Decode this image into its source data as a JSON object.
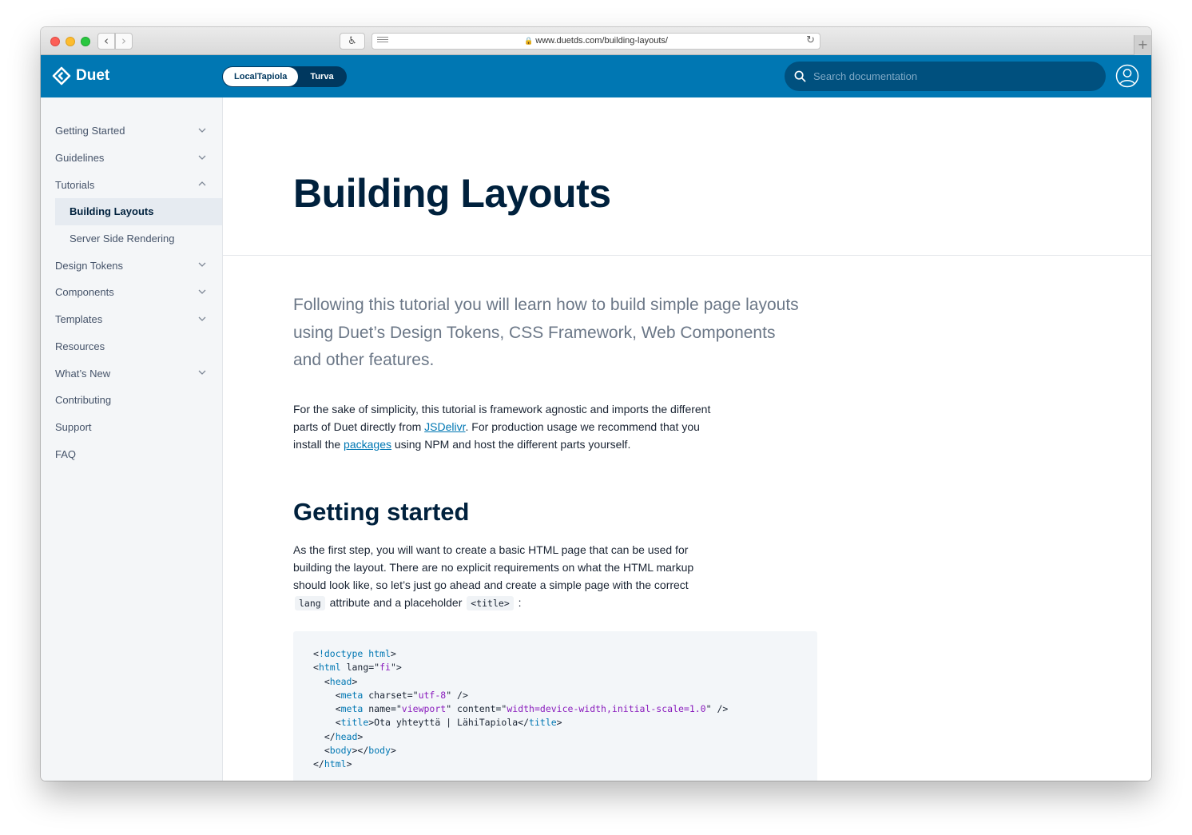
{
  "browser": {
    "url": "www.duetds.com/building-layouts/",
    "back_label": "‹",
    "forward_label": "›",
    "accessibility_glyph": "♿",
    "reload_glyph": "↻",
    "newtab_glyph": "+"
  },
  "header": {
    "logo_text": "Duet",
    "theme_options": [
      "LocalTapiola",
      "Turva"
    ],
    "active_theme": "LocalTapiola",
    "search_placeholder": "Search documentation",
    "brand_color": "#0077b3"
  },
  "sidebar": {
    "items": [
      {
        "label": "Getting Started",
        "chevron": "down"
      },
      {
        "label": "Guidelines",
        "chevron": "down"
      },
      {
        "label": "Tutorials",
        "chevron": "up"
      },
      {
        "label": "Building Layouts",
        "sub": true,
        "active": true
      },
      {
        "label": "Server Side Rendering",
        "sub": true
      },
      {
        "label": "Design Tokens",
        "chevron": "down"
      },
      {
        "label": "Components",
        "chevron": "down"
      },
      {
        "label": "Templates",
        "chevron": "down"
      },
      {
        "label": "Resources"
      },
      {
        "label": "What’s New",
        "chevron": "down"
      },
      {
        "label": "Contributing"
      },
      {
        "label": "Support"
      },
      {
        "label": "FAQ"
      }
    ]
  },
  "main": {
    "title": "Building Layouts",
    "lead": "Following this tutorial you will learn how to build simple page layouts using Duet’s Design Tokens, CSS Framework, Web Components and other features.",
    "p1": {
      "t1": "For the sake of simplicity, this tutorial is framework agnostic and imports the different parts of Duet directly from ",
      "link1": "JSDelivr",
      "t2": ". For production usage we recommend that you install the ",
      "link2": "packages",
      "t3": " using NPM and host the different parts yourself."
    },
    "h2": "Getting started",
    "p2": {
      "t1": "As the first step, you will want to create a basic HTML page that can be used for building the layout. There are no explicit requirements on what the HTML markup should look like, so let’s just go ahead and create a simple page with the correct ",
      "code1": "lang",
      "t2": " attribute and a placeholder ",
      "code2": "<title>",
      "t3": " :"
    },
    "code_lines": [
      "<!doctype html>",
      "<html lang=\"fi\">",
      "  <head>",
      "    <meta charset=\"utf-8\" />",
      "    <meta name=\"viewport\" content=\"width=device-width,initial-scale=1.0\" />",
      "    <title>Ota yhteyttä | LähiTapiola</title>",
      "  </head>",
      "  <body></body>",
      "</html>"
    ]
  }
}
